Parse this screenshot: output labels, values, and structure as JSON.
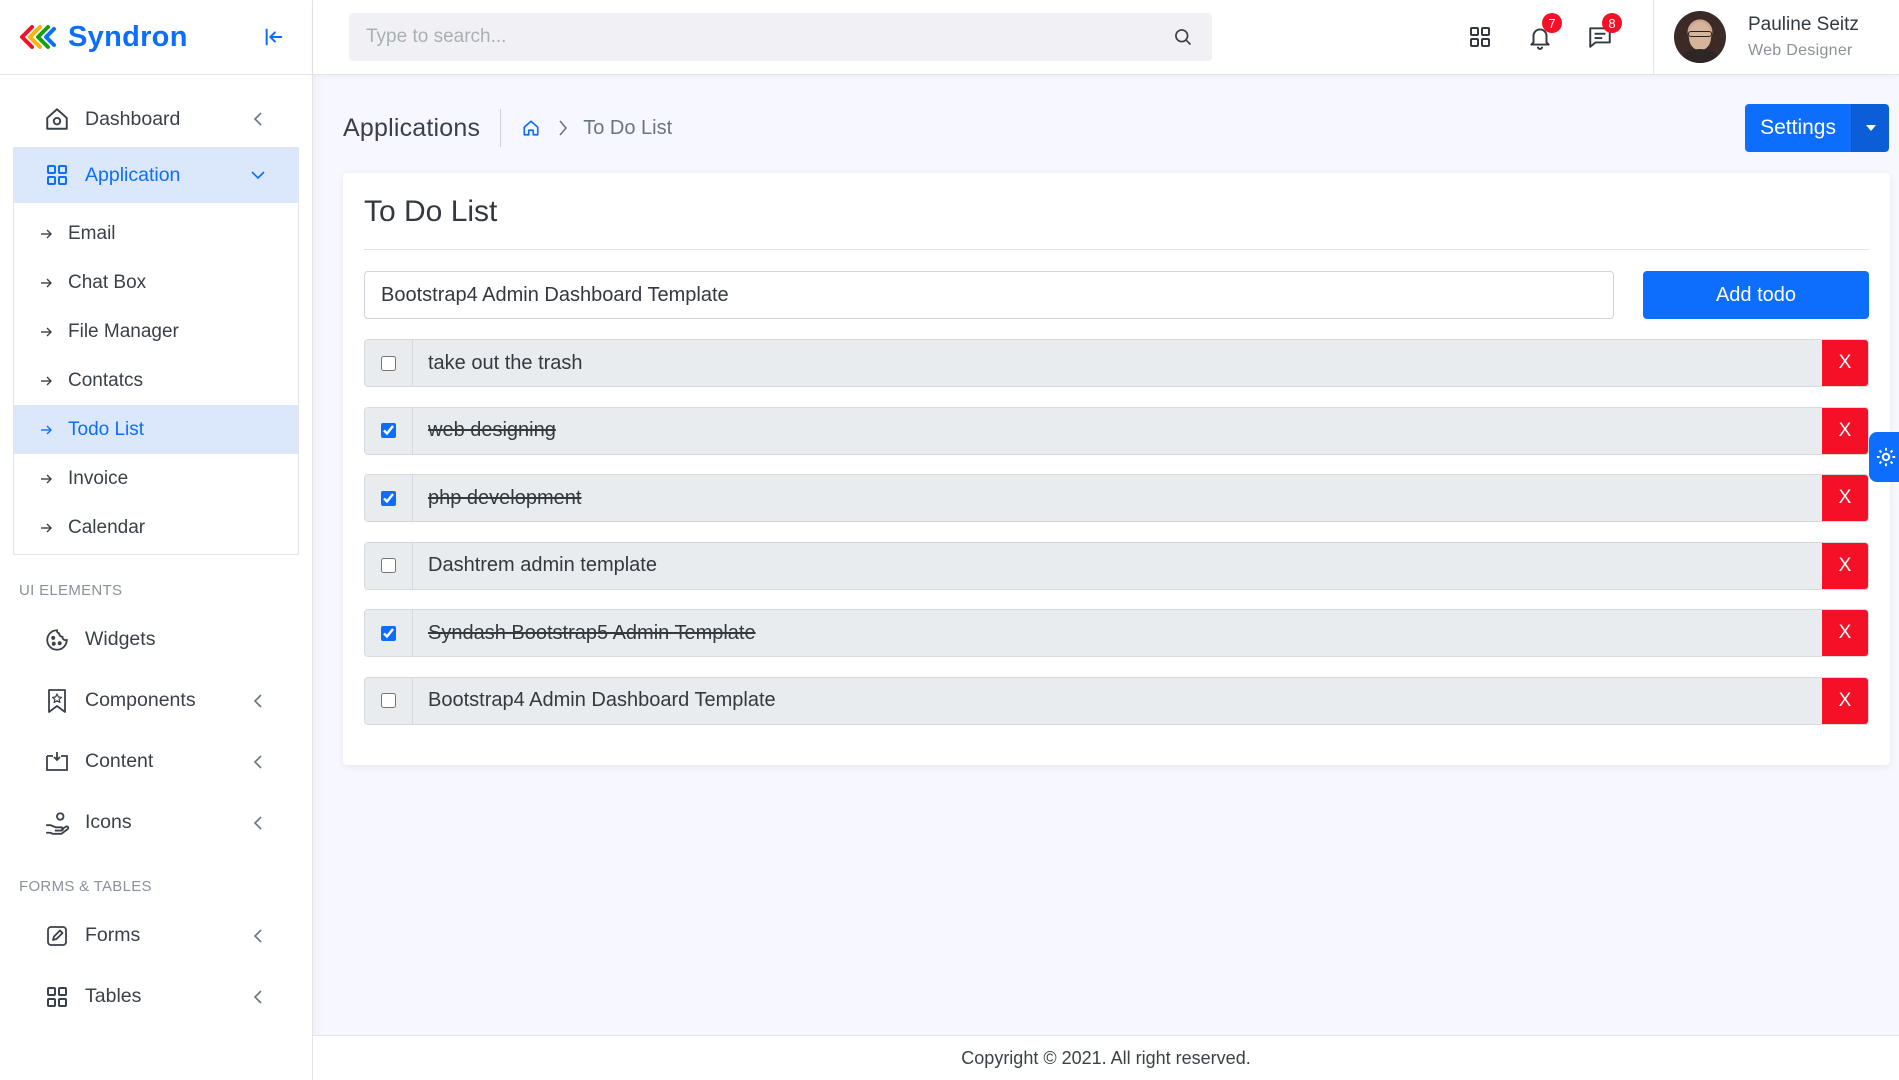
{
  "brand": {
    "name": "Syndron"
  },
  "search": {
    "placeholder": "Type to search..."
  },
  "topbar": {
    "notifications_count": "7",
    "messages_count": "8",
    "user": {
      "name": "Pauline Seitz",
      "role": "Web Designer"
    }
  },
  "sidebar": {
    "items": [
      {
        "label": "Dashboard"
      },
      {
        "label": "Application"
      }
    ],
    "application_sub": [
      {
        "label": "Email"
      },
      {
        "label": "Chat Box"
      },
      {
        "label": "File Manager"
      },
      {
        "label": "Contatcs"
      },
      {
        "label": "Todo List"
      },
      {
        "label": "Invoice"
      },
      {
        "label": "Calendar"
      }
    ],
    "section_ui": "UI ELEMENTS",
    "ui_items": [
      {
        "label": "Widgets"
      },
      {
        "label": "Components"
      },
      {
        "label": "Content"
      },
      {
        "label": "Icons"
      }
    ],
    "section_forms": "FORMS & TABLES",
    "forms_items": [
      {
        "label": "Forms"
      },
      {
        "label": "Tables"
      }
    ]
  },
  "page_header": {
    "title": "Applications",
    "breadcrumb_current": "To Do List",
    "settings_label": "Settings"
  },
  "card": {
    "title": "To Do List",
    "input_value": "Bootstrap4 Admin Dashboard Template",
    "add_label": "Add todo",
    "delete_label": "X",
    "todos": [
      {
        "text": "take out the trash",
        "done": false
      },
      {
        "text": "web designing",
        "done": true
      },
      {
        "text": "php development",
        "done": true
      },
      {
        "text": "Dashtrem admin template",
        "done": false
      },
      {
        "text": "Syndash Bootstrap5 Admin Template",
        "done": true
      },
      {
        "text": "Bootstrap4 Admin Dashboard Template",
        "done": false
      }
    ]
  },
  "footer": {
    "text": "Copyright © 2021. All right reserved."
  },
  "colors": {
    "primary": "#0d6efd",
    "danger": "#f41127",
    "active_bg": "#dbe7fb"
  }
}
